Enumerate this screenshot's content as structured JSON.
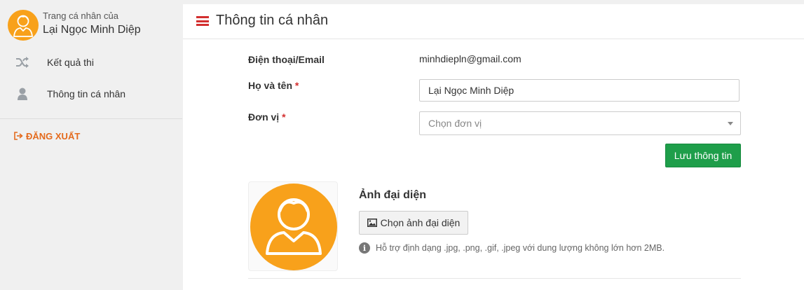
{
  "sidebar": {
    "profile_caption": "Trang cá nhân của",
    "profile_name": "Lại Ngọc Minh Diệp",
    "items": [
      {
        "label": "Kết quả thi",
        "icon": "shuffle-icon"
      },
      {
        "label": "Thông tin cá nhân",
        "icon": "user-icon"
      }
    ],
    "logout_label": "ĐĂNG XUẤT"
  },
  "header": {
    "title": "Thông tin cá nhân"
  },
  "form": {
    "contact_label": "Điện thoại/Email",
    "contact_value": "minhdiepln@gmail.com",
    "name_label": "Họ và tên",
    "name_value": "Lại Ngọc Minh Diệp",
    "unit_label": "Đơn vị",
    "unit_placeholder": "Chọn đơn vị",
    "required_mark": "*",
    "save_label": "Lưu thông tin"
  },
  "avatar": {
    "heading": "Ảnh đại diện",
    "choose_label": "Chọn ảnh đại diện",
    "hint": "Hỗ trợ định dạng .jpg, .png, .gif, .jpeg với dung lượng không lớn hơn 2MB."
  },
  "colors": {
    "accent_orange": "#f8a11b",
    "logout": "#e46a1c",
    "save_green": "#1e9e4a",
    "hamburger_red": "#d32f2f"
  }
}
